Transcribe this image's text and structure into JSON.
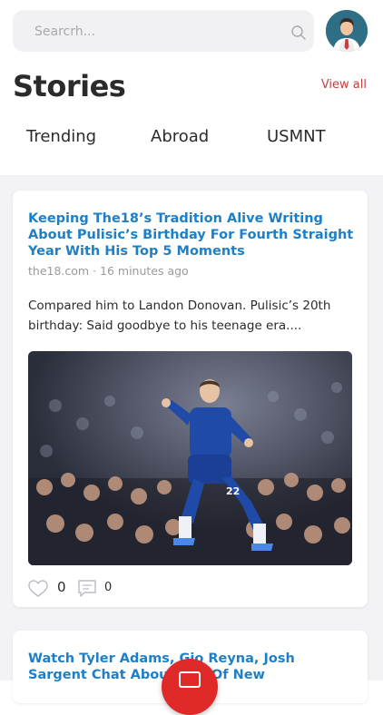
{
  "search": {
    "placeholder": "Searcrh..."
  },
  "header": {
    "title": "Stories",
    "view_all": "View all"
  },
  "tabs": [
    {
      "label": "Trending"
    },
    {
      "label": "Abroad"
    },
    {
      "label": "USMNT"
    }
  ],
  "cards": [
    {
      "headline": "Keeping The18’s Tradition Alive Writing About Pulisic’s Birthday For Fourth Straight Year With His Top 5 Moments",
      "source": "the18.com",
      "time": "16 minutes ago",
      "excerpt": "Compared him to Landon Donovan. Pulisic’s 20th birthday: Said goodbye to his teenage era....",
      "jersey_number": "22",
      "likes": "0",
      "comments": "0"
    },
    {
      "headline": "Watch Tyler Adams, Gio Reyna, Josh Sargent Chat About Life Of New"
    }
  ],
  "colors": {
    "accent": "#c2403a",
    "link": "#1f7fc6",
    "fab": "#e02a2a"
  },
  "icons": [
    "search-icon",
    "avatar",
    "heart-icon",
    "comment-icon",
    "fab-icon"
  ]
}
